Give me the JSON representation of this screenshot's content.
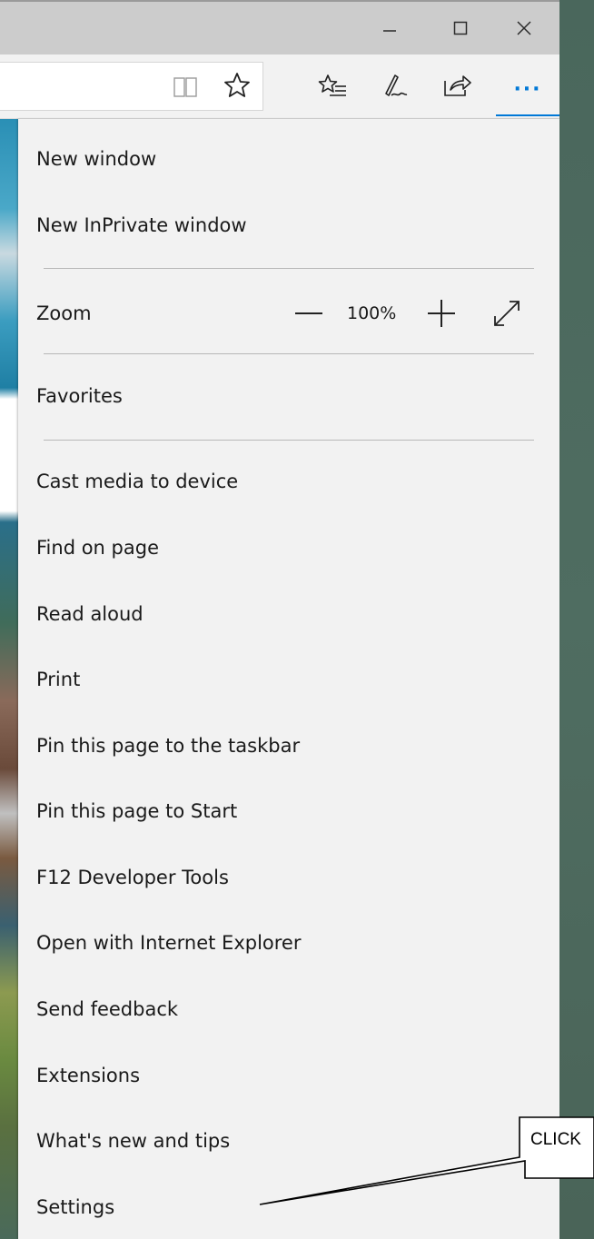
{
  "window": {
    "minimize_label": "—",
    "maximize_label": "☐",
    "close_label": "✕"
  },
  "toolbar": {
    "address_value": "",
    "icons": [
      "reading-view-icon",
      "star-icon",
      "favorites-list-icon",
      "pen-icon",
      "share-icon",
      "more-icon"
    ],
    "more_label": "···"
  },
  "menu": {
    "new_window": "New window",
    "new_inprivate_window": "New InPrivate window",
    "zoom_label": "Zoom",
    "zoom_value": "100%",
    "favorites": "Favorites",
    "cast_media": "Cast media to device",
    "find_on_page": "Find on page",
    "read_aloud": "Read aloud",
    "print": "Print",
    "pin_taskbar": "Pin this page to the taskbar",
    "pin_start": "Pin this page to Start",
    "dev_tools": "F12 Developer Tools",
    "open_ie": "Open with Internet Explorer",
    "send_feedback": "Send feedback",
    "extensions": "Extensions",
    "whats_new": "What's new and tips",
    "settings": "Settings"
  },
  "callout": {
    "text": "CLICK"
  },
  "colors": {
    "accent": "#0078d7",
    "menu_bg": "#f2f2f2",
    "titlebar_bg": "#cccccc",
    "desktop_bg": "#4b695d"
  }
}
